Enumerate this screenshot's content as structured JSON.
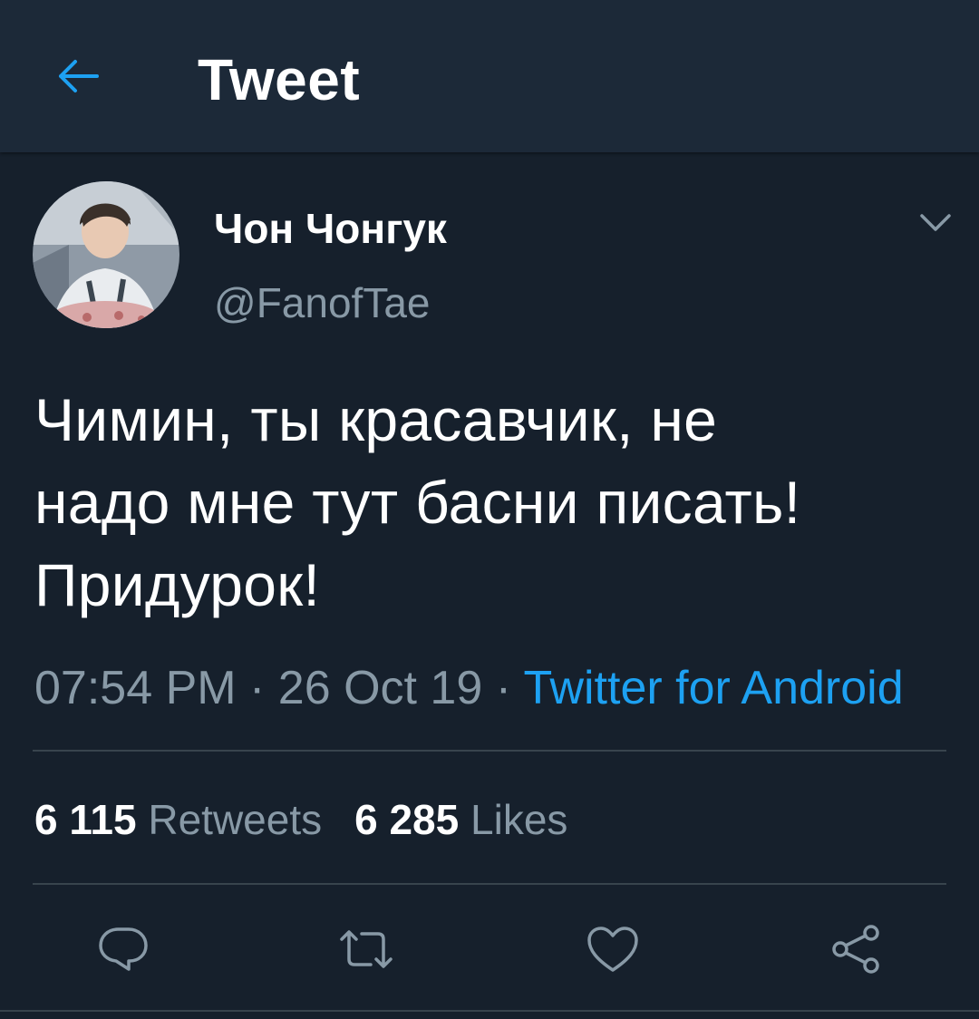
{
  "header": {
    "title": "Tweet",
    "back_icon": "arrow-left-icon"
  },
  "colors": {
    "background": "#16202c",
    "header_background": "#1c2938",
    "accent": "#1da1f2",
    "secondary_text": "#8899a6",
    "divider": "#38444d"
  },
  "tweet": {
    "author": {
      "display_name": "Чон Чонгук",
      "handle": "@FanofTae",
      "avatar_icon": "profile-photo"
    },
    "menu_icon": "chevron-down-icon",
    "text_lines": [
      "Чимин, ты красавчик, не",
      "надо мне тут басни писать!",
      "Придурок!"
    ],
    "time": "07:54 PM",
    "date": "26 Oct 19",
    "separator": " · ",
    "source": "Twitter for Android",
    "stats": {
      "retweets_count": "6 115",
      "retweets_label": "Retweets",
      "likes_count": "6 285",
      "likes_label": "Likes"
    },
    "actions": [
      {
        "icon": "reply-icon"
      },
      {
        "icon": "retweet-icon"
      },
      {
        "icon": "like-icon"
      },
      {
        "icon": "share-icon"
      }
    ]
  }
}
